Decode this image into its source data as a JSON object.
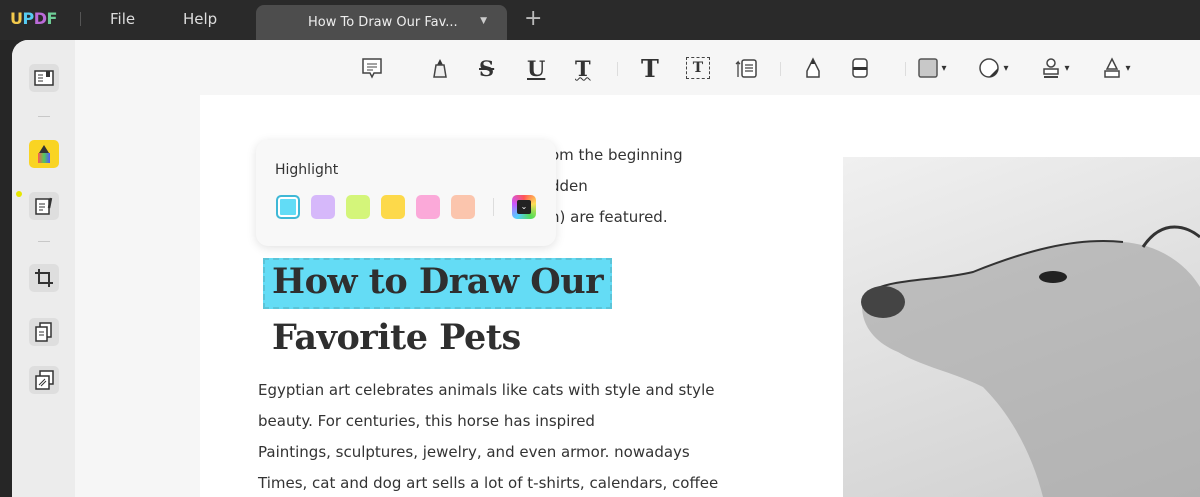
{
  "app": {
    "logo": "UPDF",
    "menu": [
      "File",
      "Help"
    ],
    "tab_title": "How To Draw Our Fav...",
    "new_tab": "+"
  },
  "sidebar": {
    "items": [
      "reader-icon",
      "comment-highlighter-icon",
      "edit-pdf-icon",
      "crop-icon",
      "organize-pages-icon",
      "convert-icon"
    ],
    "active": "comment-highlighter-icon"
  },
  "toolbar": {
    "tools": [
      "comment-icon",
      "highlight-icon",
      "strikethrough-icon",
      "underline-icon",
      "squiggly-icon",
      "text-icon",
      "textbox-icon",
      "text-callout-icon",
      "pencil-icon",
      "eraser-icon",
      "shape-icon",
      "sticker-icon",
      "stamp-icon",
      "signature-icon"
    ],
    "labels": {
      "strike": "S",
      "underline": "U",
      "squiggly": "T",
      "text": "T",
      "textbox": "T"
    }
  },
  "popup": {
    "title": "Highlight",
    "colors": [
      "#62dcf6",
      "#d6b8fa",
      "#d4f57a",
      "#fdd94a",
      "#fba9d9",
      "#fbc5ad"
    ],
    "selected": 0
  },
  "document": {
    "intro_lines": [
      "om the beginning",
      "dden",
      "n) are featured."
    ],
    "heading_line1": "How to Draw Our",
    "heading_line2": "Favorite Pets",
    "paragraph": [
      "Egyptian art celebrates animals like cats with style and style",
      "beauty. For centuries, this horse has inspired",
      "Paintings, sculptures, jewelry, and even armor. nowadays",
      "Times, cat and dog art sells a lot of t-shirts, calendars, coffee"
    ]
  }
}
